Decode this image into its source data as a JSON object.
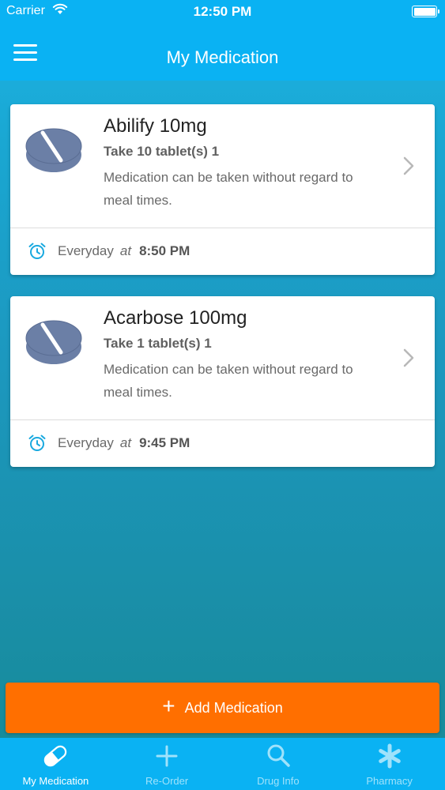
{
  "status_bar": {
    "carrier": "Carrier",
    "time": "12:50 PM"
  },
  "nav": {
    "title": "My Medication"
  },
  "medications": [
    {
      "name": "Abilify 10mg",
      "dose": "Take 10 tablet(s) 1",
      "note": "Medication can be taken without regard to meal times.",
      "frequency": "Everyday",
      "at": "at",
      "time": "8:50 PM"
    },
    {
      "name": "Acarbose 100mg",
      "dose": "Take 1 tablet(s) 1",
      "note": "Medication can be taken without regard to meal times.",
      "frequency": "Everyday",
      "at": "at",
      "time": "9:45 PM"
    }
  ],
  "add_button": {
    "label": "Add Medication"
  },
  "tabs": [
    {
      "label": "My Medication",
      "icon": "pill-icon",
      "active": true
    },
    {
      "label": "Re-Order",
      "icon": "plus-icon",
      "active": false
    },
    {
      "label": "Drug Info",
      "icon": "search-icon",
      "active": false
    },
    {
      "label": "Pharmacy",
      "icon": "asterisk-icon",
      "active": false
    }
  ],
  "colors": {
    "bar_blue": "#0ab2f3",
    "add_orange": "#ff6f00",
    "pill_slate": "#6b7fa6",
    "alarm_cyan": "#1aa9df"
  }
}
